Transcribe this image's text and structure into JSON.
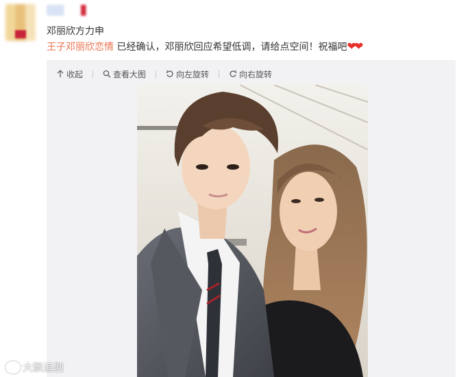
{
  "post": {
    "author_line": "邓丽欣方力申",
    "topic_link": "王子邓丽欣恋情",
    "content_text": " 已经确认，邓丽欣回应希望低调，请给点空间！祝福吧",
    "hearts": "❤❤"
  },
  "toolbar": {
    "collapse": "收起",
    "view_large": "查看大图",
    "rotate_left": "向左旋转",
    "rotate_right": "向右旋转"
  },
  "watermark": "大飘追剧",
  "colors": {
    "topic": "#eb7350",
    "heart": "#e8302b",
    "media_bg": "#f2f2f5"
  }
}
